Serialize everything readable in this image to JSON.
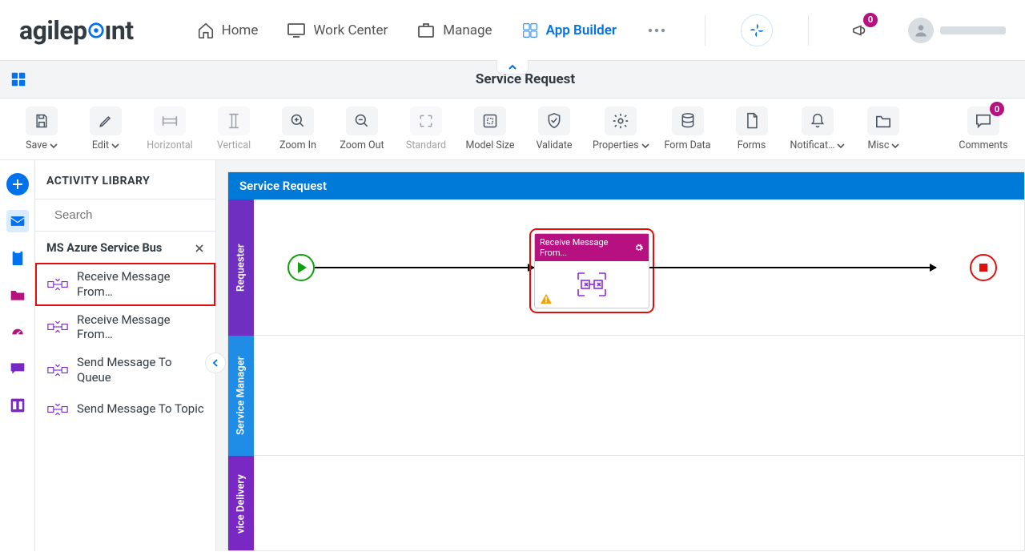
{
  "brand": "agilepoint",
  "nav": {
    "home": "Home",
    "work_center": "Work Center",
    "manage": "Manage",
    "app_builder": "App Builder"
  },
  "announcement_badge": "0",
  "page_title": "Service Request",
  "toolbar": {
    "save": "Save",
    "edit": "Edit",
    "horizontal": "Horizontal",
    "vertical": "Vertical",
    "zoom_in": "Zoom In",
    "zoom_out": "Zoom Out",
    "standard": "Standard",
    "model_size": "Model Size",
    "validate": "Validate",
    "properties": "Properties",
    "form_data": "Form Data",
    "forms": "Forms",
    "notifications": "Notificat…",
    "misc": "Misc",
    "comments": "Comments",
    "comments_badge": "0"
  },
  "library": {
    "title": "ACTIVITY LIBRARY",
    "search_placeholder": "Search",
    "group": "MS Azure Service Bus",
    "items": [
      "Receive Message From…",
      "Receive Message From…",
      "Send Message To Queue",
      "Send Message To Topic"
    ]
  },
  "canvas": {
    "title": "Service Request",
    "lanes": {
      "requester": "Requester",
      "manager": "Service Manager",
      "delivery": "vice Delivery"
    },
    "activity": {
      "title": "Receive Message From..."
    }
  }
}
